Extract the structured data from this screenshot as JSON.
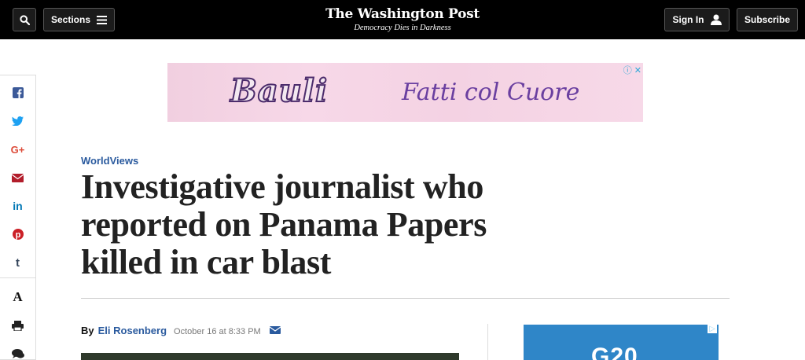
{
  "header": {
    "sections_label": "Sections",
    "logo": "The Washington Post",
    "tagline": "Democracy Dies in Darkness",
    "signin_label": "Sign In",
    "subscribe_label": "Subscribe"
  },
  "share_rail": {
    "items": [
      {
        "name": "facebook",
        "glyph": "f",
        "color": "#3b5998"
      },
      {
        "name": "twitter",
        "glyph": "🐦",
        "color": "#1da1f2"
      },
      {
        "name": "google-plus",
        "glyph": "G+",
        "color": "#dd4b39"
      },
      {
        "name": "email",
        "glyph": "✉",
        "color": "#b21d2b"
      },
      {
        "name": "linkedin",
        "glyph": "in",
        "color": "#0077b5"
      },
      {
        "name": "pinterest",
        "glyph": "P",
        "color": "#cb2027"
      },
      {
        "name": "tumblr",
        "glyph": "t",
        "color": "#35465c"
      }
    ],
    "tools": [
      {
        "name": "text-size",
        "glyph": "A"
      },
      {
        "name": "print",
        "glyph": "🖶"
      },
      {
        "name": "comments",
        "glyph": "💬"
      }
    ]
  },
  "ad_top": {
    "brand": "Bauli",
    "slogan": "Fatti col Cuore"
  },
  "article": {
    "kicker": "WorldViews",
    "headline": "Investigative journalist who reported on Panama Papers killed in car blast",
    "byline_prefix": "By",
    "author": "Eli Rosenberg",
    "date": "October 16 at 8:33 PM"
  },
  "ad_side": {
    "text": "G20"
  }
}
